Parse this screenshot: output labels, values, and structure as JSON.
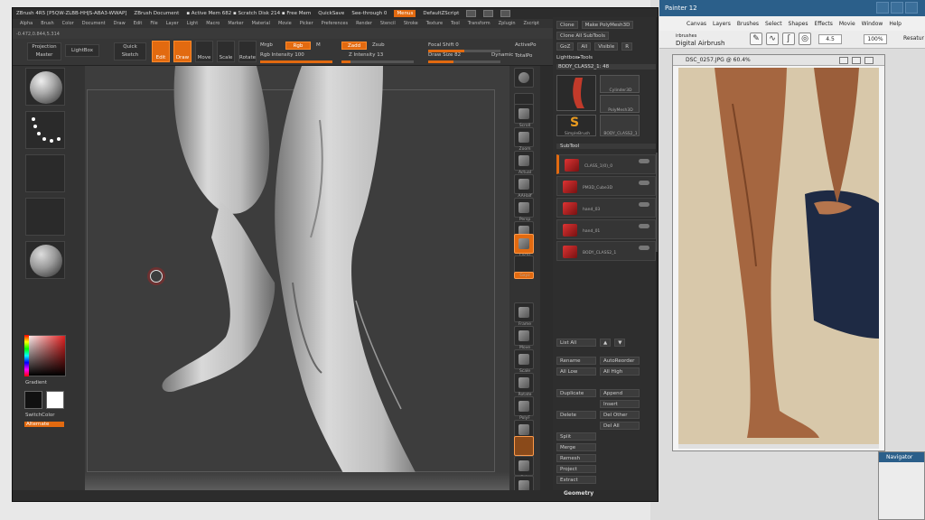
{
  "zbrush": {
    "title": "ZBrush 4R5 [P5QW-ZLBB-HHJS-ABA3-WWAP]",
    "document": "ZBrush Document",
    "memory": "▪ Active Mem 682 ▪ Scratch Disk 214 ▪ Free Mem",
    "quicksave": "QuickSave",
    "see_through": "See-through  0",
    "menus_badge": "Menus",
    "default_script": "DefaultZScript",
    "menu": [
      "Alpha",
      "Brush",
      "Color",
      "Document",
      "Draw",
      "Edit",
      "File",
      "Layer",
      "Light",
      "Macro",
      "Marker",
      "Material",
      "Movie",
      "Picker",
      "Preferences",
      "Render",
      "Stencil",
      "Stroke",
      "Texture",
      "Tool",
      "Transform",
      "Zplugin",
      "Zscript"
    ],
    "coords": "-0.472,0.844,5.314",
    "toolbar": {
      "projection_master": "Projection Master",
      "lightbox": "LightBox",
      "quick_sketch": "Quick Sketch",
      "edit": "Edit",
      "draw": "Draw",
      "move": "Move",
      "scale": "Scale",
      "rotate": "Rotate",
      "mrgb": "Mrgb",
      "rgb": "Rgb",
      "m": "M",
      "rgb_intensity": "Rgb Intensity 100",
      "zadd": "Zadd",
      "zsub": "Zsub",
      "z_intensity": "Z Intensity 13",
      "focal_shift": "Focal Shift 0",
      "draw_size": "Draw Size 82",
      "dynamic": "Dynamic",
      "active_points": "ActivePo",
      "total_points": "TotalPo"
    },
    "left_shelf": {
      "color_label": "Gradient",
      "switch_color": "SwitchColor",
      "alternate": "Alternate",
      "swatch_primary": "#111111",
      "swatch_secondary": "#ffffff"
    },
    "right_shelf": [
      "SPix 3",
      "Scroll",
      "Zoom",
      "Actual",
      "AAHalf",
      "Persp",
      "Floor",
      "Local",
      "L.Sym",
      "Gxyz",
      "Frame",
      "Move",
      "Scale",
      "Rotate",
      "PolyF",
      "Transp",
      "Ghost",
      "Solo",
      "Xpose"
    ],
    "right_panel": {
      "top_row1": [
        "Clone",
        "Make PolyMesh3D"
      ],
      "top_row2": [
        "Clone All SubTools"
      ],
      "top_row3": [
        "GoZ",
        "All",
        "Visible",
        "R"
      ],
      "lightbox_tools": "Lightbox▸Tools",
      "body_class": "BODY_CLASS2_1: 48",
      "thumbs": [
        "Cylinder3D",
        "PolyMesh3D",
        "SimpleBrush",
        "BODY_CLASS2_1"
      ],
      "subtool_title": "SubTool",
      "subtools": [
        "CLASS_1(0)_0",
        "PM3D_Cube3D",
        "hand_03",
        "hand_01",
        "BODY_CLASS2_1"
      ],
      "list_all": "List All",
      "rename": "Rename",
      "auto_reorder": "AutoReorder",
      "all_low": "All Low",
      "all_high": "All High",
      "duplicate": "Duplicate",
      "append": "Append",
      "insert": "Insert",
      "delete": "Delete",
      "del_other": "Del Other",
      "del_all": "Del All",
      "split": "Split",
      "merge": "Merge",
      "remesh": "Remesh",
      "project": "Project",
      "extract": "Extract",
      "geometry": "Geometry"
    }
  },
  "painter": {
    "title": "Painter 12",
    "menu": [
      "Canvas",
      "Layers",
      "Brushes",
      "Select",
      "Shapes",
      "Effects",
      "Movie",
      "Window",
      "Help"
    ],
    "brush_category": "irbrushes",
    "brush_name": "Digital Airbrush",
    "size_value": "4.5",
    "opacity_value": "100%",
    "resat_label": "Resatur",
    "doc_title": "DSC_0257.JPG @ 60.4%",
    "navigator": "Navigator"
  },
  "colors": {
    "accent": "#e26a10",
    "zbrush_bg": "#3a3a3a",
    "painter_title": "#2b5f8a"
  }
}
